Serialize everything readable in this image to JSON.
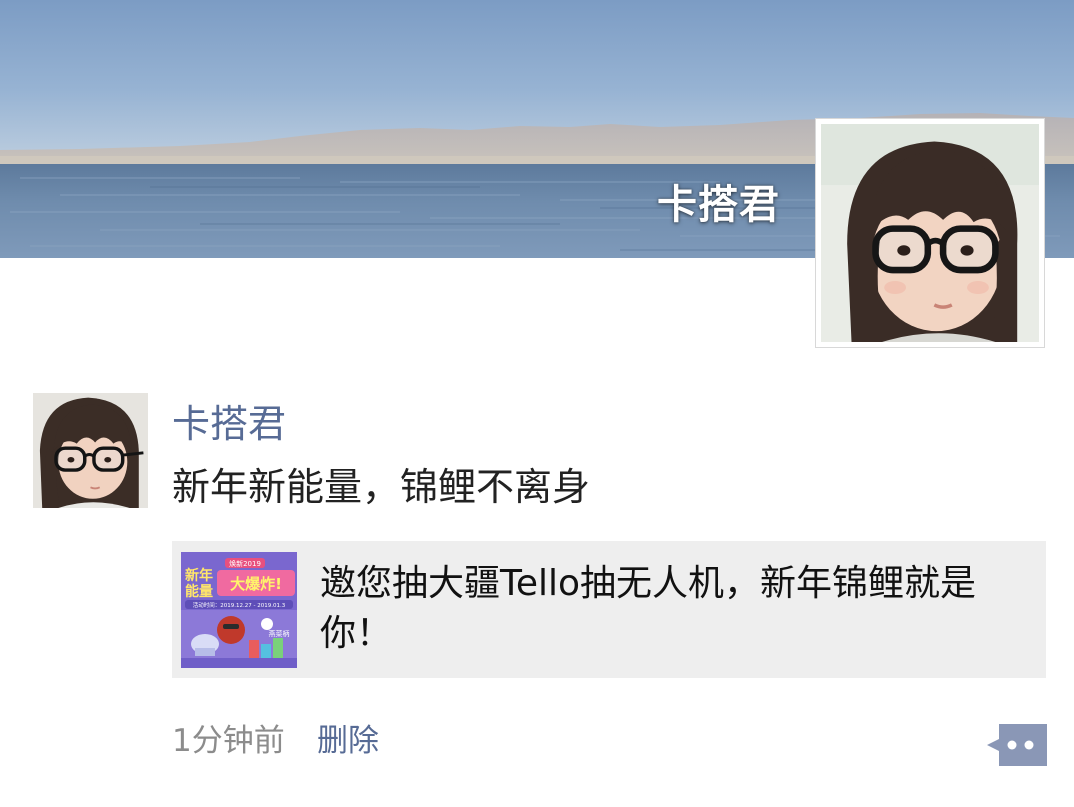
{
  "profile": {
    "cover_name": "卡搭君"
  },
  "post": {
    "author": "卡搭君",
    "text": "新年新能量，锦鲤不离身",
    "shared_link": {
      "title": "邀您抽大疆Tello抽无人机，新年锦鲤就是你！",
      "thumbnail": {
        "line1": "新年",
        "line2": "能量",
        "big_text": "大爆炸!",
        "small_badge": "焕新2019",
        "date_range": "活动时间：2019.12.27 - 2019.01.3",
        "bottom_label": "燕菜柄"
      }
    },
    "time": "1分钟前",
    "delete_label": "删除",
    "more_icon": "comment-more-icon"
  },
  "colors": {
    "link_blue": "#576b95",
    "card_bg": "#eeeeee",
    "timestamp_gray": "#8c8c8c"
  }
}
